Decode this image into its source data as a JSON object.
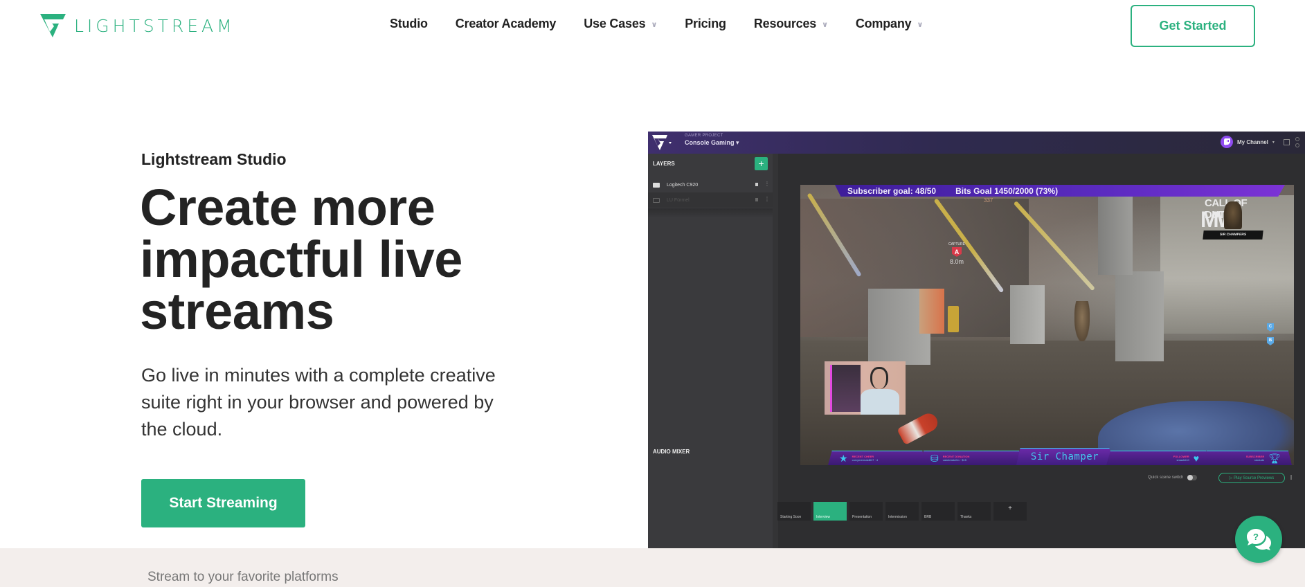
{
  "header": {
    "brand": "LIGHTSTREAM",
    "brand_color": "#2bb17f",
    "nav": [
      {
        "label": "Studio",
        "has_dropdown": false
      },
      {
        "label": "Creator Academy",
        "has_dropdown": false
      },
      {
        "label": "Use Cases",
        "has_dropdown": true
      },
      {
        "label": "Pricing",
        "has_dropdown": false
      },
      {
        "label": "Resources",
        "has_dropdown": true
      },
      {
        "label": "Company",
        "has_dropdown": true
      }
    ],
    "chevron_glyph": "∨",
    "cta_label": "Get Started"
  },
  "hero": {
    "eyebrow": "Lightstream Studio",
    "headline": "Create more impactful live streams",
    "subtext": "Go live in minutes with a complete creative suite right in your browser and powered by the cloud.",
    "cta_label": "Start Streaming"
  },
  "platforms": {
    "label": "Stream to your favorite platforms"
  },
  "app_preview": {
    "project_label": "GAMER PROJECT",
    "project_name": "Console Gaming",
    "dropdown_glyph": "▾",
    "channel_name": "My Channel",
    "layers_title": "LAYERS",
    "add_glyph": "+",
    "layers": [
      {
        "name": "Logitech C920",
        "icon": "camera-icon",
        "dim": false
      },
      {
        "name": "LU Fürmel",
        "icon": "image-icon",
        "dim": true
      }
    ],
    "audio_mixer_title": "AUDIO MIXER",
    "overlay": {
      "subscriber_goal": "Subscriber goal: 48/50",
      "bits_goal": "Bits Goal 1450/2000 (73%)",
      "hud_number": "337",
      "capture_label": "CAPTURE",
      "capture_point": "A",
      "capture_distance": "8.0m",
      "game_title": "CALL OF DUTY",
      "game_subtitle": "MW",
      "player_tag": "SIR CHAMPERS",
      "rank_badges": [
        "C",
        "B"
      ],
      "alerts": {
        "recent_cheer_label": "RECENT CHEER",
        "recent_cheer_value": "curvymermaid817 · 4",
        "recent_donation_label": "RECENT DONATION",
        "recent_donation_value": "valorintato0m · $15",
        "streamer_name": "Sir Champer",
        "follower_label": "FOLLOWER",
        "follower_value": "smashit10",
        "subscriber_label": "SUBSCRIBER",
        "subscriber_value": "rokdude"
      }
    },
    "quick_scene_label": "Quick scene switch",
    "quick_scene_on": false,
    "play_previews_label": "▷ Play Source Previews",
    "scenes": [
      {
        "label": "Starting Soon",
        "active": false
      },
      {
        "label": "Interview",
        "active": true
      },
      {
        "label": "Presentation",
        "active": false
      },
      {
        "label": "Intermission",
        "active": false
      },
      {
        "label": "BRB",
        "active": false
      },
      {
        "label": "Thanks",
        "active": false
      }
    ],
    "add_scene_glyph": "+"
  },
  "chat_widget": {
    "icon": "help-chat-icon"
  }
}
